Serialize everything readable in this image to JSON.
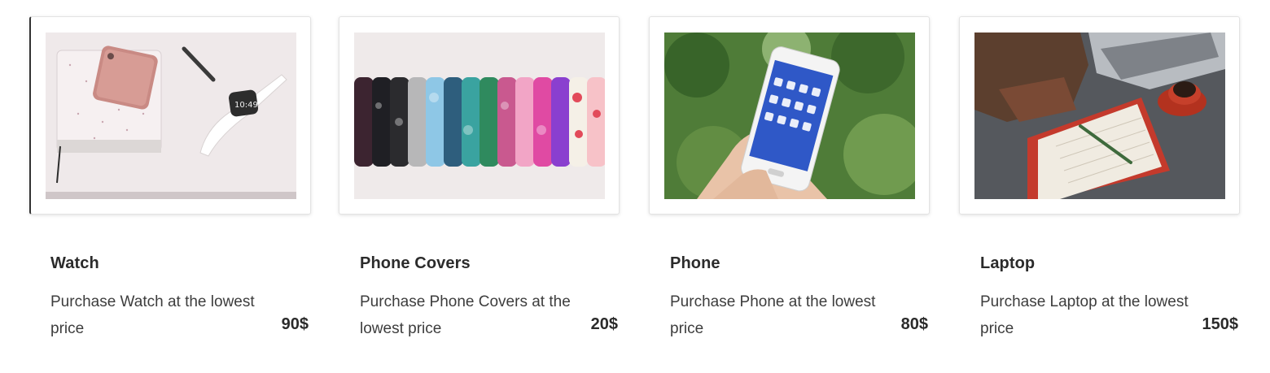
{
  "products": [
    {
      "name": "Watch",
      "description": "Purchase Watch at the lowest price",
      "price": "90$",
      "image": "watch-phone-notebook-photo"
    },
    {
      "name": "Phone Covers",
      "description": "Purchase Phone Covers at the lowest price",
      "price": "20$",
      "image": "phone-covers-row-photo"
    },
    {
      "name": "Phone",
      "description": "Purchase Phone at the lowest price",
      "price": "80$",
      "image": "hand-holding-phone-photo"
    },
    {
      "name": "Laptop",
      "description": "Purchase Laptop at the lowest price",
      "price": "150$",
      "image": "laptop-desk-photo"
    }
  ],
  "colors": {
    "background": "#ffffff",
    "text": "#2f2f2f",
    "card_border": "#e3e3e3"
  }
}
